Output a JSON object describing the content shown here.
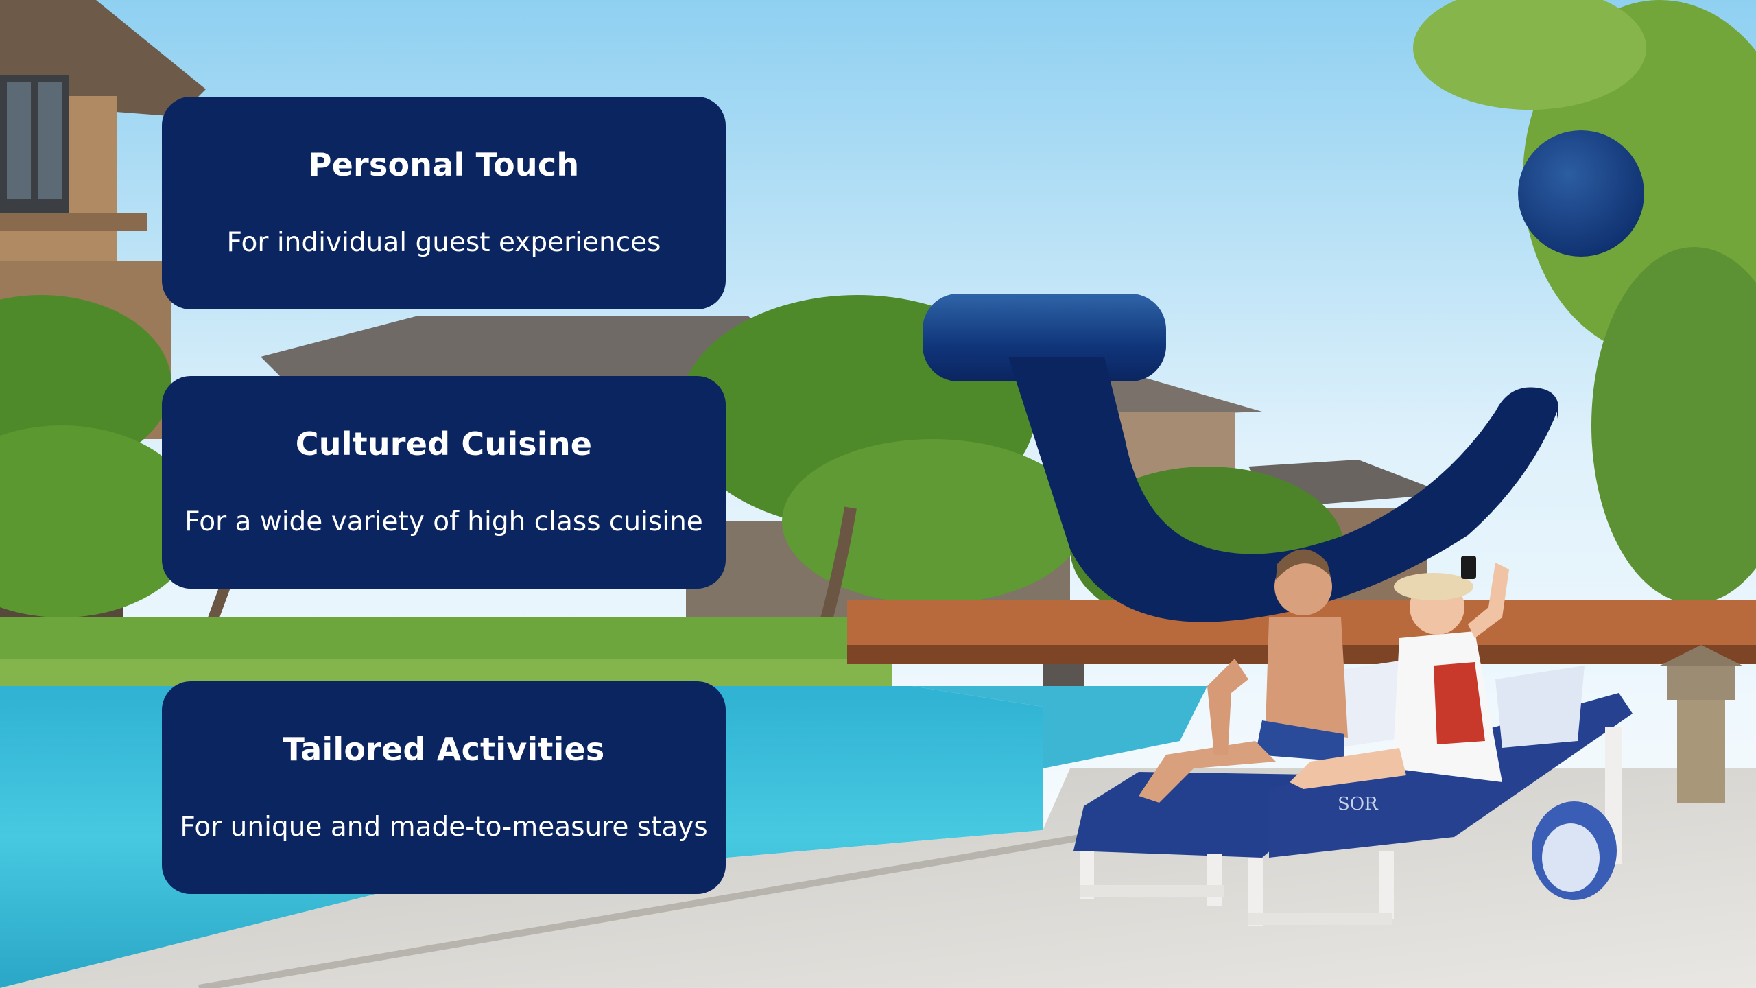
{
  "features": [
    {
      "title": "Personal Touch",
      "subtitle": "For individual guest experiences"
    },
    {
      "title": "Cultured Cuisine",
      "subtitle": "For a wide variety of high class cuisine"
    },
    {
      "title": "Tailored Activities",
      "subtitle": "For unique and made-to-measure stays"
    }
  ],
  "background": {
    "towel_text": "SOR",
    "brand_color": "#0b2560",
    "pool_color": "#3fc3dd",
    "sky_color": "#bfe1f5"
  }
}
